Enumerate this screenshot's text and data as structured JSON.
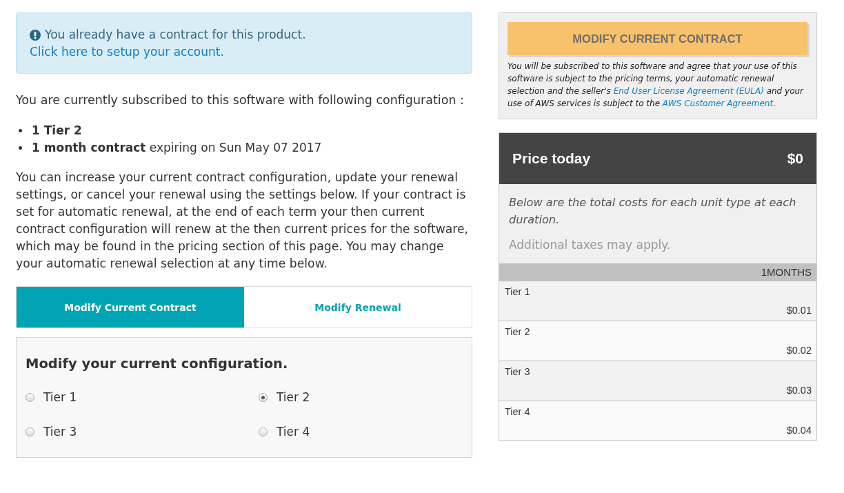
{
  "alert": {
    "message": "You already have a contract for this product.",
    "link": "Click here to setup your account."
  },
  "subscription": {
    "intro": "You are currently subscribed to this software with following configuration :",
    "items": [
      {
        "term": "1 Tier 2"
      },
      {
        "term": "1 month contract",
        "detail": "expiring on Sun May 07 2017"
      }
    ],
    "explanation": "You can increase your current contract configuration, update your renewal settings, or cancel your renewal using the settings below. If your contract is set for automatic renewal, at the end of each term your then current contract configuration will renew at the then current prices for the software, which may be found in the pricing section of this page. You may change your automatic renewal selection at any time below."
  },
  "tabs": [
    {
      "label": "Modify Current Contract",
      "selected": true
    },
    {
      "label": "Modify Renewal",
      "selected": false
    }
  ],
  "configuration": {
    "title": "Modify your current configuration.",
    "options": [
      {
        "label": "Tier 1",
        "selected": false
      },
      {
        "label": "Tier 2",
        "selected": true
      },
      {
        "label": "Tier 3",
        "selected": false
      },
      {
        "label": "Tier 4",
        "selected": false
      }
    ]
  },
  "purchase": {
    "button": {
      "label": "MODIFY CURRENT CONTRACT",
      "disabled": true
    },
    "terms": [
      {
        "kind": "text",
        "text": "You will be subscribed to this software and agree that your use of this software is subject to the pricing terms, your automatic renewal selection and the seller's "
      },
      {
        "kind": "link",
        "text": "End User License Agreement (EULA)"
      },
      {
        "kind": "text",
        "text": " and your use of AWS services is subject to the "
      },
      {
        "kind": "link",
        "text": "AWS Customer Agreement"
      },
      {
        "kind": "text",
        "text": "."
      }
    ]
  },
  "price": {
    "title": "Price today",
    "total": "$0",
    "note": "Below are the total costs for each unit type at each duration.",
    "tax_note": "Additional taxes may apply.",
    "column": "1MONTHS",
    "rows": [
      {
        "label": "Tier 1",
        "price": "$0.01"
      },
      {
        "label": "Tier 2",
        "price": "$0.02"
      },
      {
        "label": "Tier 3",
        "price": "$0.03"
      },
      {
        "label": "Tier 4",
        "price": "$0.04"
      }
    ]
  }
}
